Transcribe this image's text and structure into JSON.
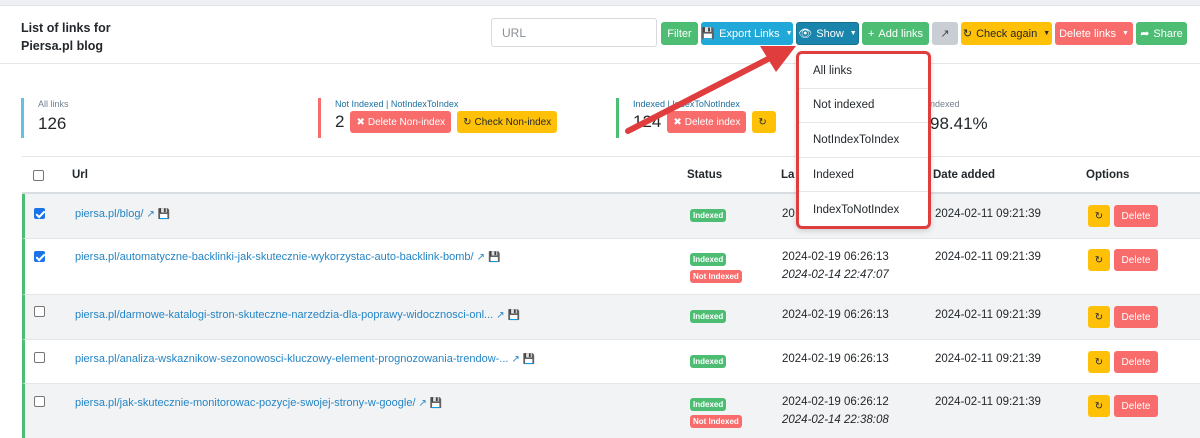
{
  "header": {
    "title_line1": "List of links for",
    "title_line2": "Piersa.pl blog",
    "url_placeholder": "URL",
    "buttons": {
      "filter": "Filter",
      "export": "Export Links",
      "show": "Show",
      "add": "Add links",
      "check_again": "Check again",
      "delete_links": "Delete links",
      "share": "Share"
    }
  },
  "stats": {
    "all_label": "All links",
    "all_value": "126",
    "non_label": "Not Indexed | NotIndexToIndex",
    "non_value": "2",
    "delete_non": "Delete Non-index",
    "check_non": "Check Non-index",
    "idx_label": "Indexed | IndexToNotIndex",
    "idx_value": "124",
    "delete_index": "Delete index",
    "pct_label": "ndexed",
    "pct_value": "98.41%"
  },
  "table": {
    "columns": {
      "url": "Url",
      "status": "Status",
      "last": "La",
      "added": "Date added",
      "options": "Options"
    },
    "delete_label": "Delete",
    "rows": [
      {
        "url": "piersa.pl/blog/",
        "status1": "Indexed",
        "date1": "20",
        "added": "2024-02-11 09:21:39"
      },
      {
        "url": "piersa.pl/automatyczne-backlinki-jak-skutecznie-wykorzystac-auto-backlink-bomb/",
        "status1": "Indexed",
        "status2": "Not Indexed",
        "date1": "2024-02-19 06:26:13",
        "date2": "2024-02-14 22:47:07",
        "added": "2024-02-11 09:21:39"
      },
      {
        "url": "piersa.pl/darmowe-katalogi-stron-skuteczne-narzedzia-dla-poprawy-widocznosci-onl...",
        "status1": "Indexed",
        "date1": "2024-02-19 06:26:13",
        "added": "2024-02-11 09:21:39"
      },
      {
        "url": "piersa.pl/analiza-wskaznikow-sezonowosci-kluczowy-element-prognozowania-trendow-...",
        "status1": "Indexed",
        "date1": "2024-02-19 06:26:13",
        "added": "2024-02-11 09:21:39"
      },
      {
        "url": "piersa.pl/jak-skutecznie-monitorowac-pozycje-swojej-strony-w-google/",
        "status1": "Indexed",
        "status2": "Not Indexed",
        "date1": "2024-02-19 06:26:12",
        "date2": "2024-02-14 22:38:08",
        "added": "2024-02-11 09:21:39"
      }
    ]
  },
  "dropdown": {
    "items": [
      "All links",
      "Not indexed",
      "NotIndexToIndex",
      "Indexed",
      "IndexToNotIndex"
    ]
  },
  "colors": {
    "accent_green": "#4dbd74",
    "accent_blue": "#20a8d8",
    "accent_red": "#f86c6b",
    "accent_yellow": "#ffc107",
    "annotation_red": "#e03e3e"
  }
}
